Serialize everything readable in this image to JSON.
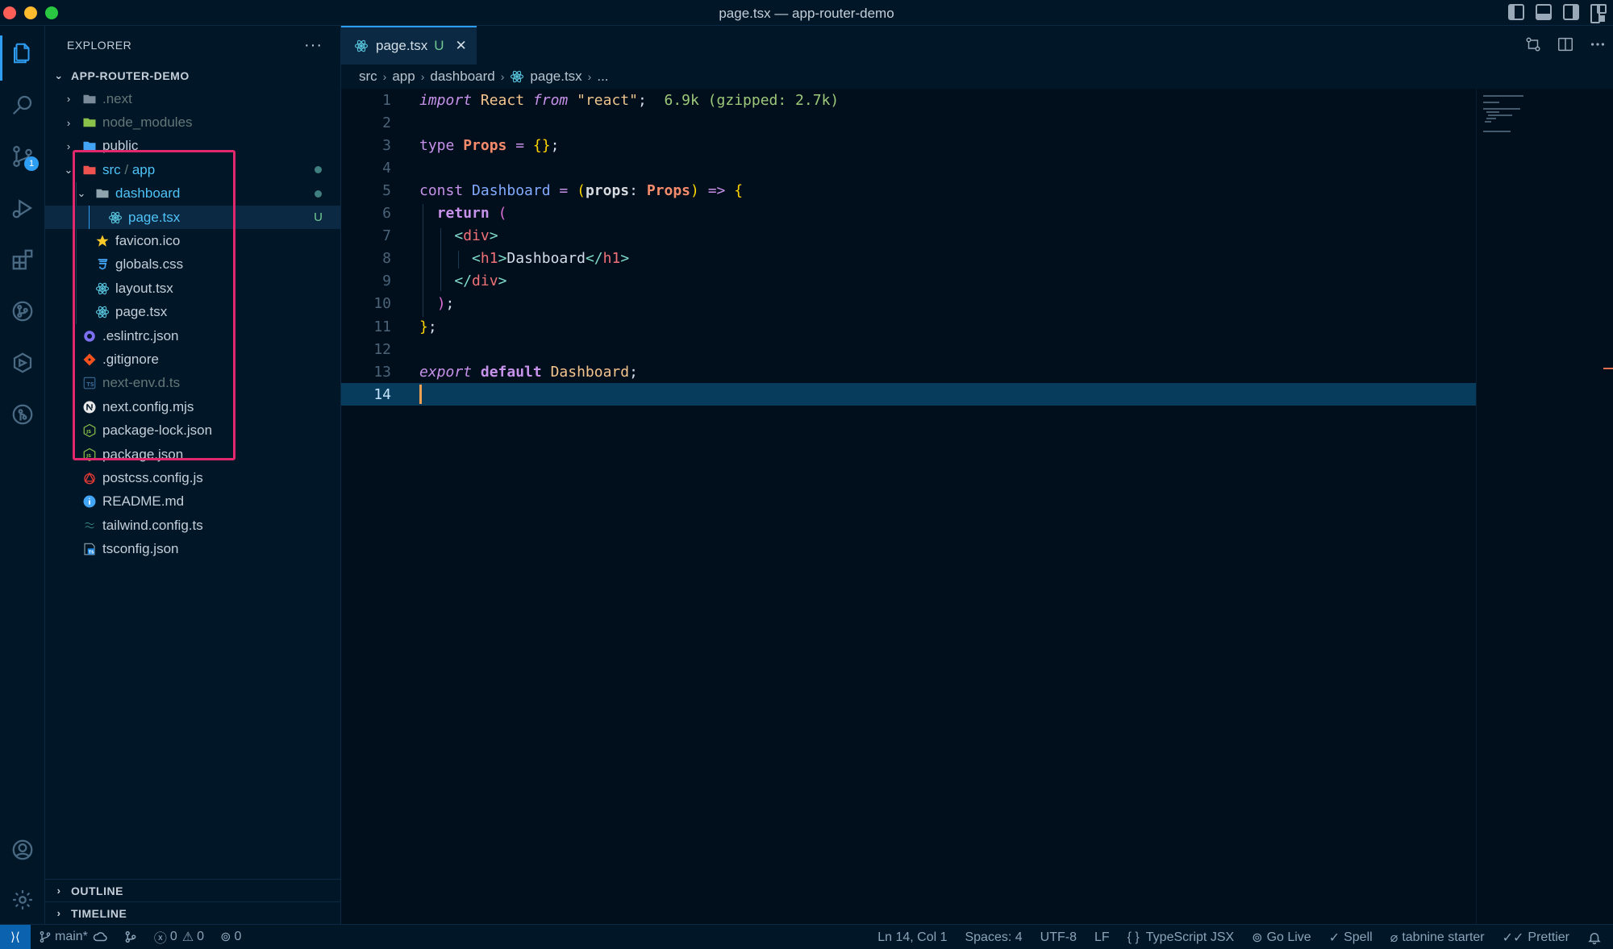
{
  "window": {
    "title": "page.tsx — app-router-demo"
  },
  "activity_bar": {
    "items": [
      {
        "name": "explorer-icon"
      },
      {
        "name": "search-icon"
      },
      {
        "name": "source-control-icon",
        "badge": "1"
      },
      {
        "name": "run-debug-icon"
      },
      {
        "name": "extensions-icon"
      },
      {
        "name": "git-graph-icon"
      },
      {
        "name": "remote-explorer-icon"
      },
      {
        "name": "git-lens-icon"
      }
    ],
    "bottom": [
      {
        "name": "account-icon"
      },
      {
        "name": "manage-gear-icon"
      }
    ]
  },
  "explorer": {
    "title": "EXPLORER",
    "more": "···",
    "root": "APP-ROUTER-DEMO",
    "tree": [
      {
        "label": ".next",
        "type": "folder",
        "depth": 0,
        "collapsed": true,
        "icon_color": "#7a8a99",
        "dim": true
      },
      {
        "label": "node_modules",
        "type": "folder",
        "depth": 0,
        "collapsed": true,
        "icon_color": "#8bc34a",
        "dim": true
      },
      {
        "label": "public",
        "type": "folder",
        "depth": 0,
        "collapsed": true,
        "icon_color": "#42a5f5"
      },
      {
        "label": "src",
        "label2": "app",
        "type": "folder",
        "depth": 0,
        "expanded": true,
        "icon_color": "#ef5350",
        "accent": true,
        "dot": true
      },
      {
        "label": "dashboard",
        "type": "folder",
        "depth": 1,
        "expanded": true,
        "icon_color": "#90a4ae",
        "accent": true,
        "dot": true
      },
      {
        "label": "page.tsx",
        "type": "react",
        "depth": 2,
        "selected": true,
        "status": "U",
        "accent": true
      },
      {
        "label": "favicon.ico",
        "type": "star",
        "depth": 1
      },
      {
        "label": "globals.css",
        "type": "css",
        "depth": 1
      },
      {
        "label": "layout.tsx",
        "type": "react",
        "depth": 1
      },
      {
        "label": "page.tsx",
        "type": "react",
        "depth": 1
      },
      {
        "label": ".eslintrc.json",
        "type": "eslint",
        "depth": 0
      },
      {
        "label": ".gitignore",
        "type": "git",
        "depth": 0
      },
      {
        "label": "next-env.d.ts",
        "type": "ts",
        "depth": 0,
        "dim": true
      },
      {
        "label": "next.config.mjs",
        "type": "next",
        "depth": 0
      },
      {
        "label": "package-lock.json",
        "type": "npm",
        "depth": 0
      },
      {
        "label": "package.json",
        "type": "npm",
        "depth": 0
      },
      {
        "label": "postcss.config.js",
        "type": "postcss",
        "depth": 0
      },
      {
        "label": "README.md",
        "type": "info",
        "depth": 0
      },
      {
        "label": "tailwind.config.ts",
        "type": "tailwind",
        "depth": 0
      },
      {
        "label": "tsconfig.json",
        "type": "tsconfig",
        "depth": 0
      }
    ],
    "outline": "OUTLINE",
    "timeline": "TIMELINE"
  },
  "editor": {
    "tab": {
      "label": "page.tsx",
      "modified": "U",
      "close": "✕"
    },
    "breadcrumb": [
      "src",
      "app",
      "dashboard",
      "page.tsx",
      "..."
    ],
    "lines": [
      "import React from \"react\";  6.9k (gzipped: 2.7k)",
      "",
      "type Props = {};",
      "",
      "const Dashboard = (props: Props) => {",
      "  return (",
      "    <div>",
      "      <h1>Dashboard</h1>",
      "    </div>",
      "  );",
      "};",
      "",
      "export default Dashboard;",
      ""
    ],
    "current_line": 14
  },
  "status_bar": {
    "branch": "main*",
    "errors": "0",
    "warnings": "0",
    "ports": "0",
    "position": "Ln 14, Col 1",
    "spaces": "Spaces: 4",
    "encoding": "UTF-8",
    "eol": "LF",
    "language": "TypeScript JSX",
    "go_live": "Go Live",
    "spell": "Spell",
    "tabnine": "tabnine starter",
    "prettier": "Prettier"
  },
  "colors": {
    "accent": "#2e9ef4",
    "highlight_box": "#e2286c",
    "background": "#011627"
  }
}
